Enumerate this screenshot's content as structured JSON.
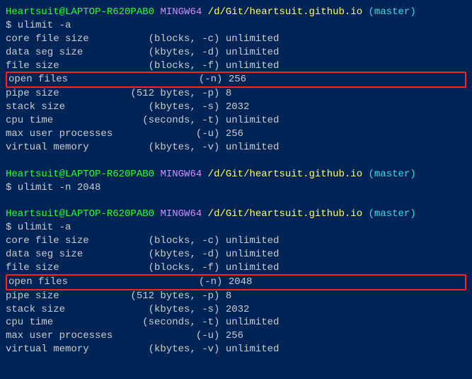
{
  "prompt1": {
    "user": "Heartsuit@LAPTOP-R620PAB0",
    "host": "MINGW64",
    "path": "/d/Git/heartsuit.github.io",
    "branch": "(master)",
    "cmd": "$ ulimit -a"
  },
  "out1": {
    "l0": "core file size          (blocks, -c) unlimited",
    "l1": "data seg size           (kbytes, -d) unlimited",
    "l2": "file size               (blocks, -f) unlimited",
    "l3": "open files                      (-n) 256",
    "l4": "pipe size            (512 bytes, -p) 8",
    "l5": "stack size              (kbytes, -s) 2032",
    "l6": "cpu time               (seconds, -t) unlimited",
    "l7": "max user processes              (-u) 256",
    "l8": "virtual memory          (kbytes, -v) unlimited"
  },
  "prompt2": {
    "user": "Heartsuit@LAPTOP-R620PAB0",
    "host": "MINGW64",
    "path": "/d/Git/heartsuit.github.io",
    "branch": "(master)",
    "cmd": "$ ulimit -n 2048"
  },
  "prompt3": {
    "user": "Heartsuit@LAPTOP-R620PAB0",
    "host": "MINGW64",
    "path": "/d/Git/heartsuit.github.io",
    "branch": "(master)",
    "cmd": "$ ulimit -a"
  },
  "out2": {
    "l0": "core file size          (blocks, -c) unlimited",
    "l1": "data seg size           (kbytes, -d) unlimited",
    "l2": "file size               (blocks, -f) unlimited",
    "l3": "open files                      (-n) 2048",
    "l4": "pipe size            (512 bytes, -p) 8",
    "l5": "stack size              (kbytes, -s) 2032",
    "l6": "cpu time               (seconds, -t) unlimited",
    "l7": "max user processes              (-u) 256",
    "l8": "virtual memory          (kbytes, -v) unlimited"
  }
}
